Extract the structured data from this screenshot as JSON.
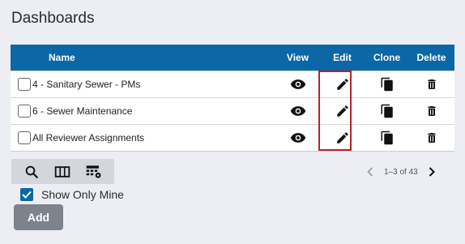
{
  "page": {
    "title": "Dashboards"
  },
  "table": {
    "headers": {
      "name": "Name",
      "view": "View",
      "edit": "Edit",
      "clone": "Clone",
      "delete": "Delete"
    },
    "rows": [
      {
        "name": "4 - Sanitary Sewer - PMs",
        "checked": false
      },
      {
        "name": "6 - Sewer Maintenance",
        "checked": false
      },
      {
        "name": "All Reviewer Assignments",
        "checked": false
      }
    ]
  },
  "toolbar": {
    "icons": [
      "search-icon",
      "columns-icon",
      "table-settings-icon"
    ]
  },
  "pagination": {
    "range": "1–3 of 43"
  },
  "filter": {
    "show_only_mine_label": "Show Only Mine",
    "show_only_mine_checked": true
  },
  "actions": {
    "add_label": "Add"
  },
  "colors": {
    "header_bg": "#0b67a8",
    "highlight": "#b5232b",
    "add_button_bg": "#7d828b",
    "page_bg": "#eceef3"
  }
}
